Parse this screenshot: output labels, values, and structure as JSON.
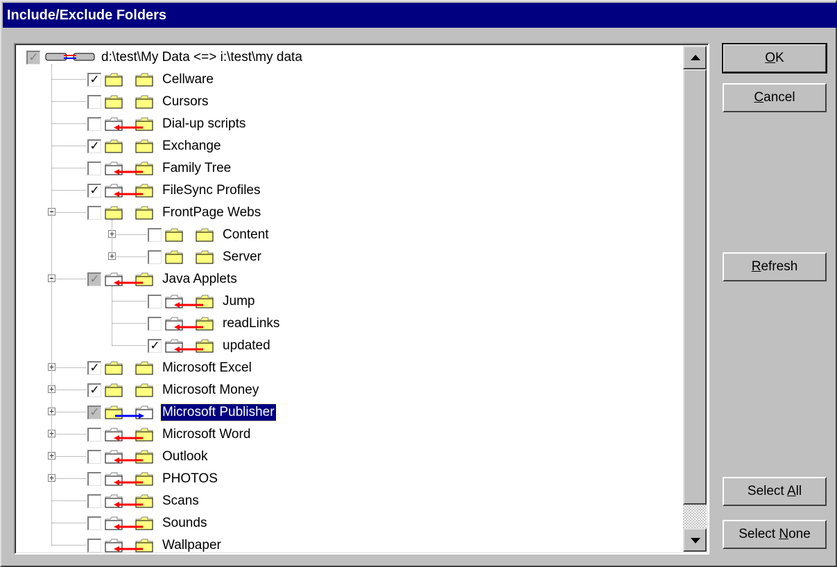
{
  "window": {
    "title": "Include/Exclude Folders"
  },
  "buttons": {
    "ok": {
      "pre": "",
      "acc": "O",
      "post": "K"
    },
    "cancel": {
      "pre": "",
      "acc": "C",
      "post": "ancel"
    },
    "refresh": {
      "pre": "",
      "acc": "R",
      "post": "efresh"
    },
    "select_all": {
      "pre": "Select ",
      "acc": "A",
      "post": "ll"
    },
    "select_none": {
      "pre": "Select ",
      "acc": "N",
      "post": "one"
    }
  },
  "tree": {
    "items": [
      {
        "label": "d:\\test\\My Data <=> i:\\test\\my data",
        "level": 0,
        "check": "grey",
        "icon": "both-link",
        "expander": ""
      },
      {
        "label": "Cellware",
        "level": 1,
        "check": "checked",
        "icon": "both",
        "expander": ""
      },
      {
        "label": "Cursors",
        "level": 1,
        "check": "unchecked",
        "icon": "both",
        "expander": ""
      },
      {
        "label": "Dial-up scripts",
        "level": 1,
        "check": "unchecked",
        "icon": "right-to-left",
        "expander": ""
      },
      {
        "label": "Exchange",
        "level": 1,
        "check": "checked",
        "icon": "both",
        "expander": ""
      },
      {
        "label": "Family Tree",
        "level": 1,
        "check": "unchecked",
        "icon": "right-to-left",
        "expander": ""
      },
      {
        "label": "FileSync Profiles",
        "level": 1,
        "check": "checked",
        "icon": "right-to-left",
        "expander": ""
      },
      {
        "label": "FrontPage Webs",
        "level": 1,
        "check": "unchecked",
        "icon": "both",
        "expander": "minus"
      },
      {
        "label": "Content",
        "level": 2,
        "check": "unchecked",
        "icon": "both",
        "expander": "plus"
      },
      {
        "label": "Server",
        "level": 2,
        "check": "unchecked",
        "icon": "both",
        "expander": "plus"
      },
      {
        "label": "Java Applets",
        "level": 1,
        "check": "grey",
        "icon": "right-to-left",
        "expander": "minus"
      },
      {
        "label": "Jump",
        "level": 2,
        "check": "unchecked",
        "icon": "right-to-left",
        "expander": ""
      },
      {
        "label": "readLinks",
        "level": 2,
        "check": "unchecked",
        "icon": "right-to-left",
        "expander": ""
      },
      {
        "label": "updated",
        "level": 2,
        "check": "checked",
        "icon": "right-to-left",
        "expander": ""
      },
      {
        "label": "Microsoft Excel",
        "level": 1,
        "check": "checked",
        "icon": "both",
        "expander": "plus"
      },
      {
        "label": "Microsoft Money",
        "level": 1,
        "check": "checked",
        "icon": "both",
        "expander": "plus"
      },
      {
        "label": "Microsoft Publisher",
        "level": 1,
        "check": "grey",
        "icon": "left-to-right",
        "expander": "plus",
        "selected": true
      },
      {
        "label": "Microsoft Word",
        "level": 1,
        "check": "unchecked",
        "icon": "right-to-left",
        "expander": "plus"
      },
      {
        "label": "Outlook",
        "level": 1,
        "check": "unchecked",
        "icon": "right-to-left",
        "expander": "plus"
      },
      {
        "label": "PHOTOS",
        "level": 1,
        "check": "unchecked",
        "icon": "right-to-left",
        "expander": "plus"
      },
      {
        "label": "Scans",
        "level": 1,
        "check": "unchecked",
        "icon": "right-to-left",
        "expander": ""
      },
      {
        "label": "Sounds",
        "level": 1,
        "check": "unchecked",
        "icon": "right-to-left",
        "expander": ""
      },
      {
        "label": "Wallpaper",
        "level": 1,
        "check": "unchecked",
        "icon": "right-to-left",
        "expander": ""
      }
    ]
  },
  "colors": {
    "titlebar": "#000080",
    "folder": "#ffff80",
    "arrow_red": "#ff0000",
    "arrow_blue": "#0000ff",
    "face": "#c0c0c0"
  }
}
